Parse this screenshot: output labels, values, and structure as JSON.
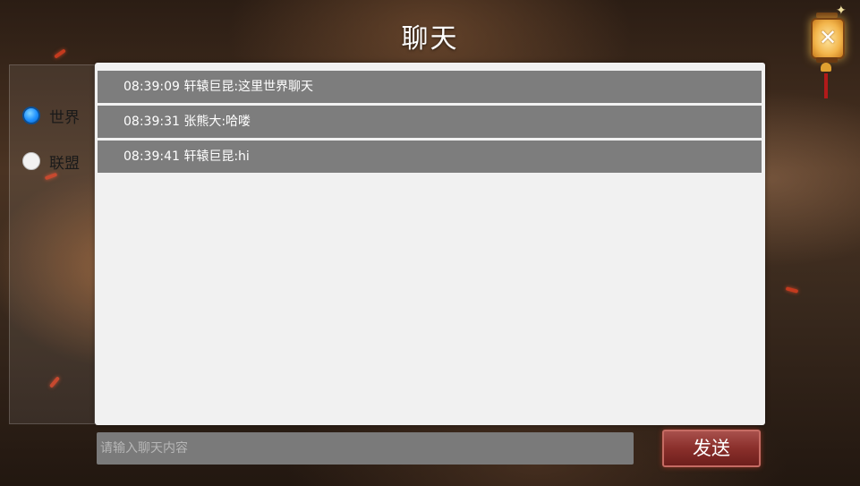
{
  "title": "聊天",
  "tabs": [
    {
      "label": "世界",
      "selected": true
    },
    {
      "label": "联盟",
      "selected": false
    }
  ],
  "messages": [
    {
      "text": "08:39:09 轩辕巨昆:这里世界聊天"
    },
    {
      "text": "08:39:31 张熊大:哈喽"
    },
    {
      "text": "08:39:41 轩辕巨昆:hi"
    }
  ],
  "input": {
    "placeholder": "请输入聊天内容",
    "value": ""
  },
  "send_label": "发送",
  "close_icon": "lantern-close-icon",
  "colors": {
    "tab_selected": "#1e90ff",
    "message_bg": "#7d7d7d",
    "panel_bg": "#f1f1f1",
    "send_button": "#8a2f2b"
  }
}
